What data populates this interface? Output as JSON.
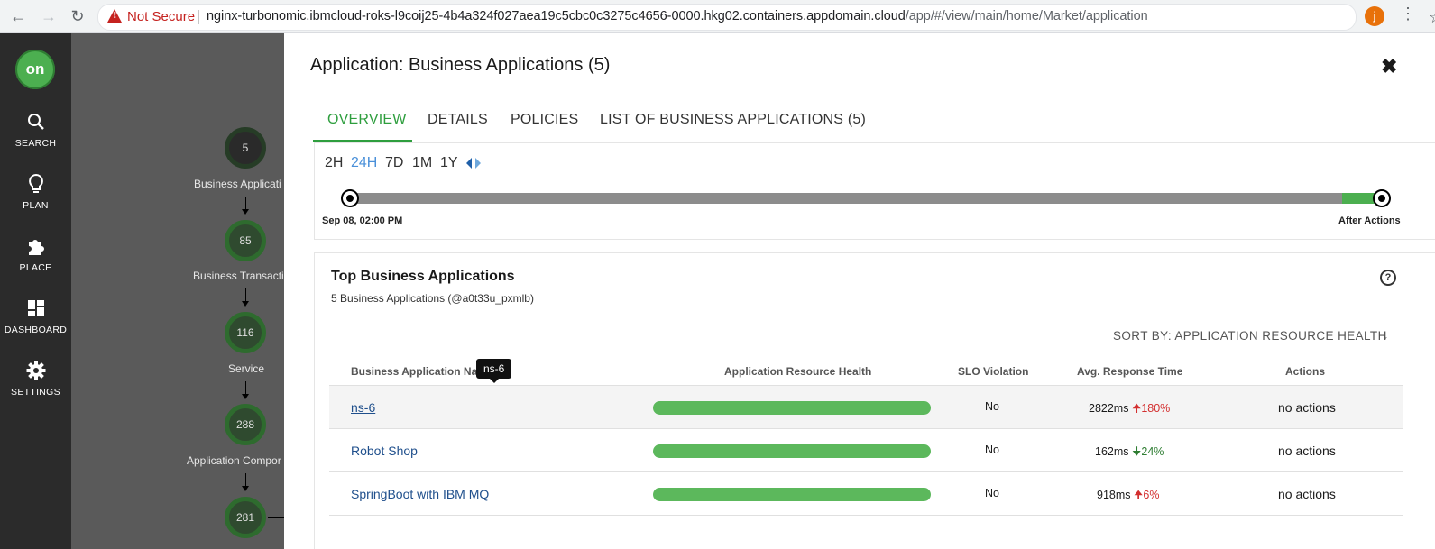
{
  "browser": {
    "security_label": "Not Secure",
    "url_host": "nginx-turbonomic.ibmcloud-roks-l9coij25-4b4a324f027aea19c5cbc0c3275c4656-0000.hkg02.containers.appdomain.cloud",
    "url_path": "/app/#/view/main/home/Market/application",
    "profile_initial": "j"
  },
  "leftnav": {
    "logo_text": "on",
    "items": [
      {
        "label": "SEARCH",
        "icon": "search-icon"
      },
      {
        "label": "PLAN",
        "icon": "lightbulb-icon"
      },
      {
        "label": "PLACE",
        "icon": "puzzle-icon"
      },
      {
        "label": "DASHBOARD",
        "icon": "dashboard-icon"
      },
      {
        "label": "SETTINGS",
        "icon": "gear-icon"
      }
    ]
  },
  "supply_chain": {
    "nodes": [
      {
        "count": "5",
        "label": "Business Applicati"
      },
      {
        "count": "85",
        "label": "Business Transacti"
      },
      {
        "count": "116",
        "label": "Service"
      },
      {
        "count": "288",
        "label": "Application Compor"
      },
      {
        "count": "281",
        "label": ""
      }
    ]
  },
  "panel": {
    "title": "Application: Business Applications (5)",
    "tabs": [
      "OVERVIEW",
      "DETAILS",
      "POLICIES",
      "LIST OF BUSINESS APPLICATIONS (5)"
    ],
    "active_tab": "OVERVIEW"
  },
  "timeline": {
    "ranges": [
      "2H",
      "24H",
      "7D",
      "1M",
      "1Y"
    ],
    "active_range": "24H",
    "start_label": "Sep 08, 02:00 PM",
    "end_label": "After Actions"
  },
  "top_apps": {
    "title": "Top Business Applications",
    "subtitle": "5 Business Applications (@a0t33u_pxmlb)",
    "sort_label": "SORT BY: APPLICATION RESOURCE HEALTH",
    "columns": [
      "Business Application Na",
      "Application Resource Health",
      "SLO Violation",
      "Avg. Response Time",
      "Actions"
    ],
    "rows": [
      {
        "name": "ns-6",
        "health": 1.0,
        "slo": "No",
        "response": "2822ms",
        "change": "180%",
        "trend": "up",
        "actions": "no actions"
      },
      {
        "name": "Robot Shop",
        "health": 1.0,
        "slo": "No",
        "response": "162ms",
        "change": "24%",
        "trend": "down",
        "actions": "no actions"
      },
      {
        "name": "SpringBoot with IBM MQ",
        "health": 1.0,
        "slo": "No",
        "response": "918ms",
        "change": "6%",
        "trend": "up",
        "actions": "no actions"
      }
    ],
    "tooltip": "ns-6"
  },
  "colors": {
    "accent_green": "#2e9e3e",
    "health_bar": "#5cb85c",
    "trend_up": "#d32f2f",
    "trend_down": "#2e7d32",
    "active_range": "#4a90d9"
  }
}
